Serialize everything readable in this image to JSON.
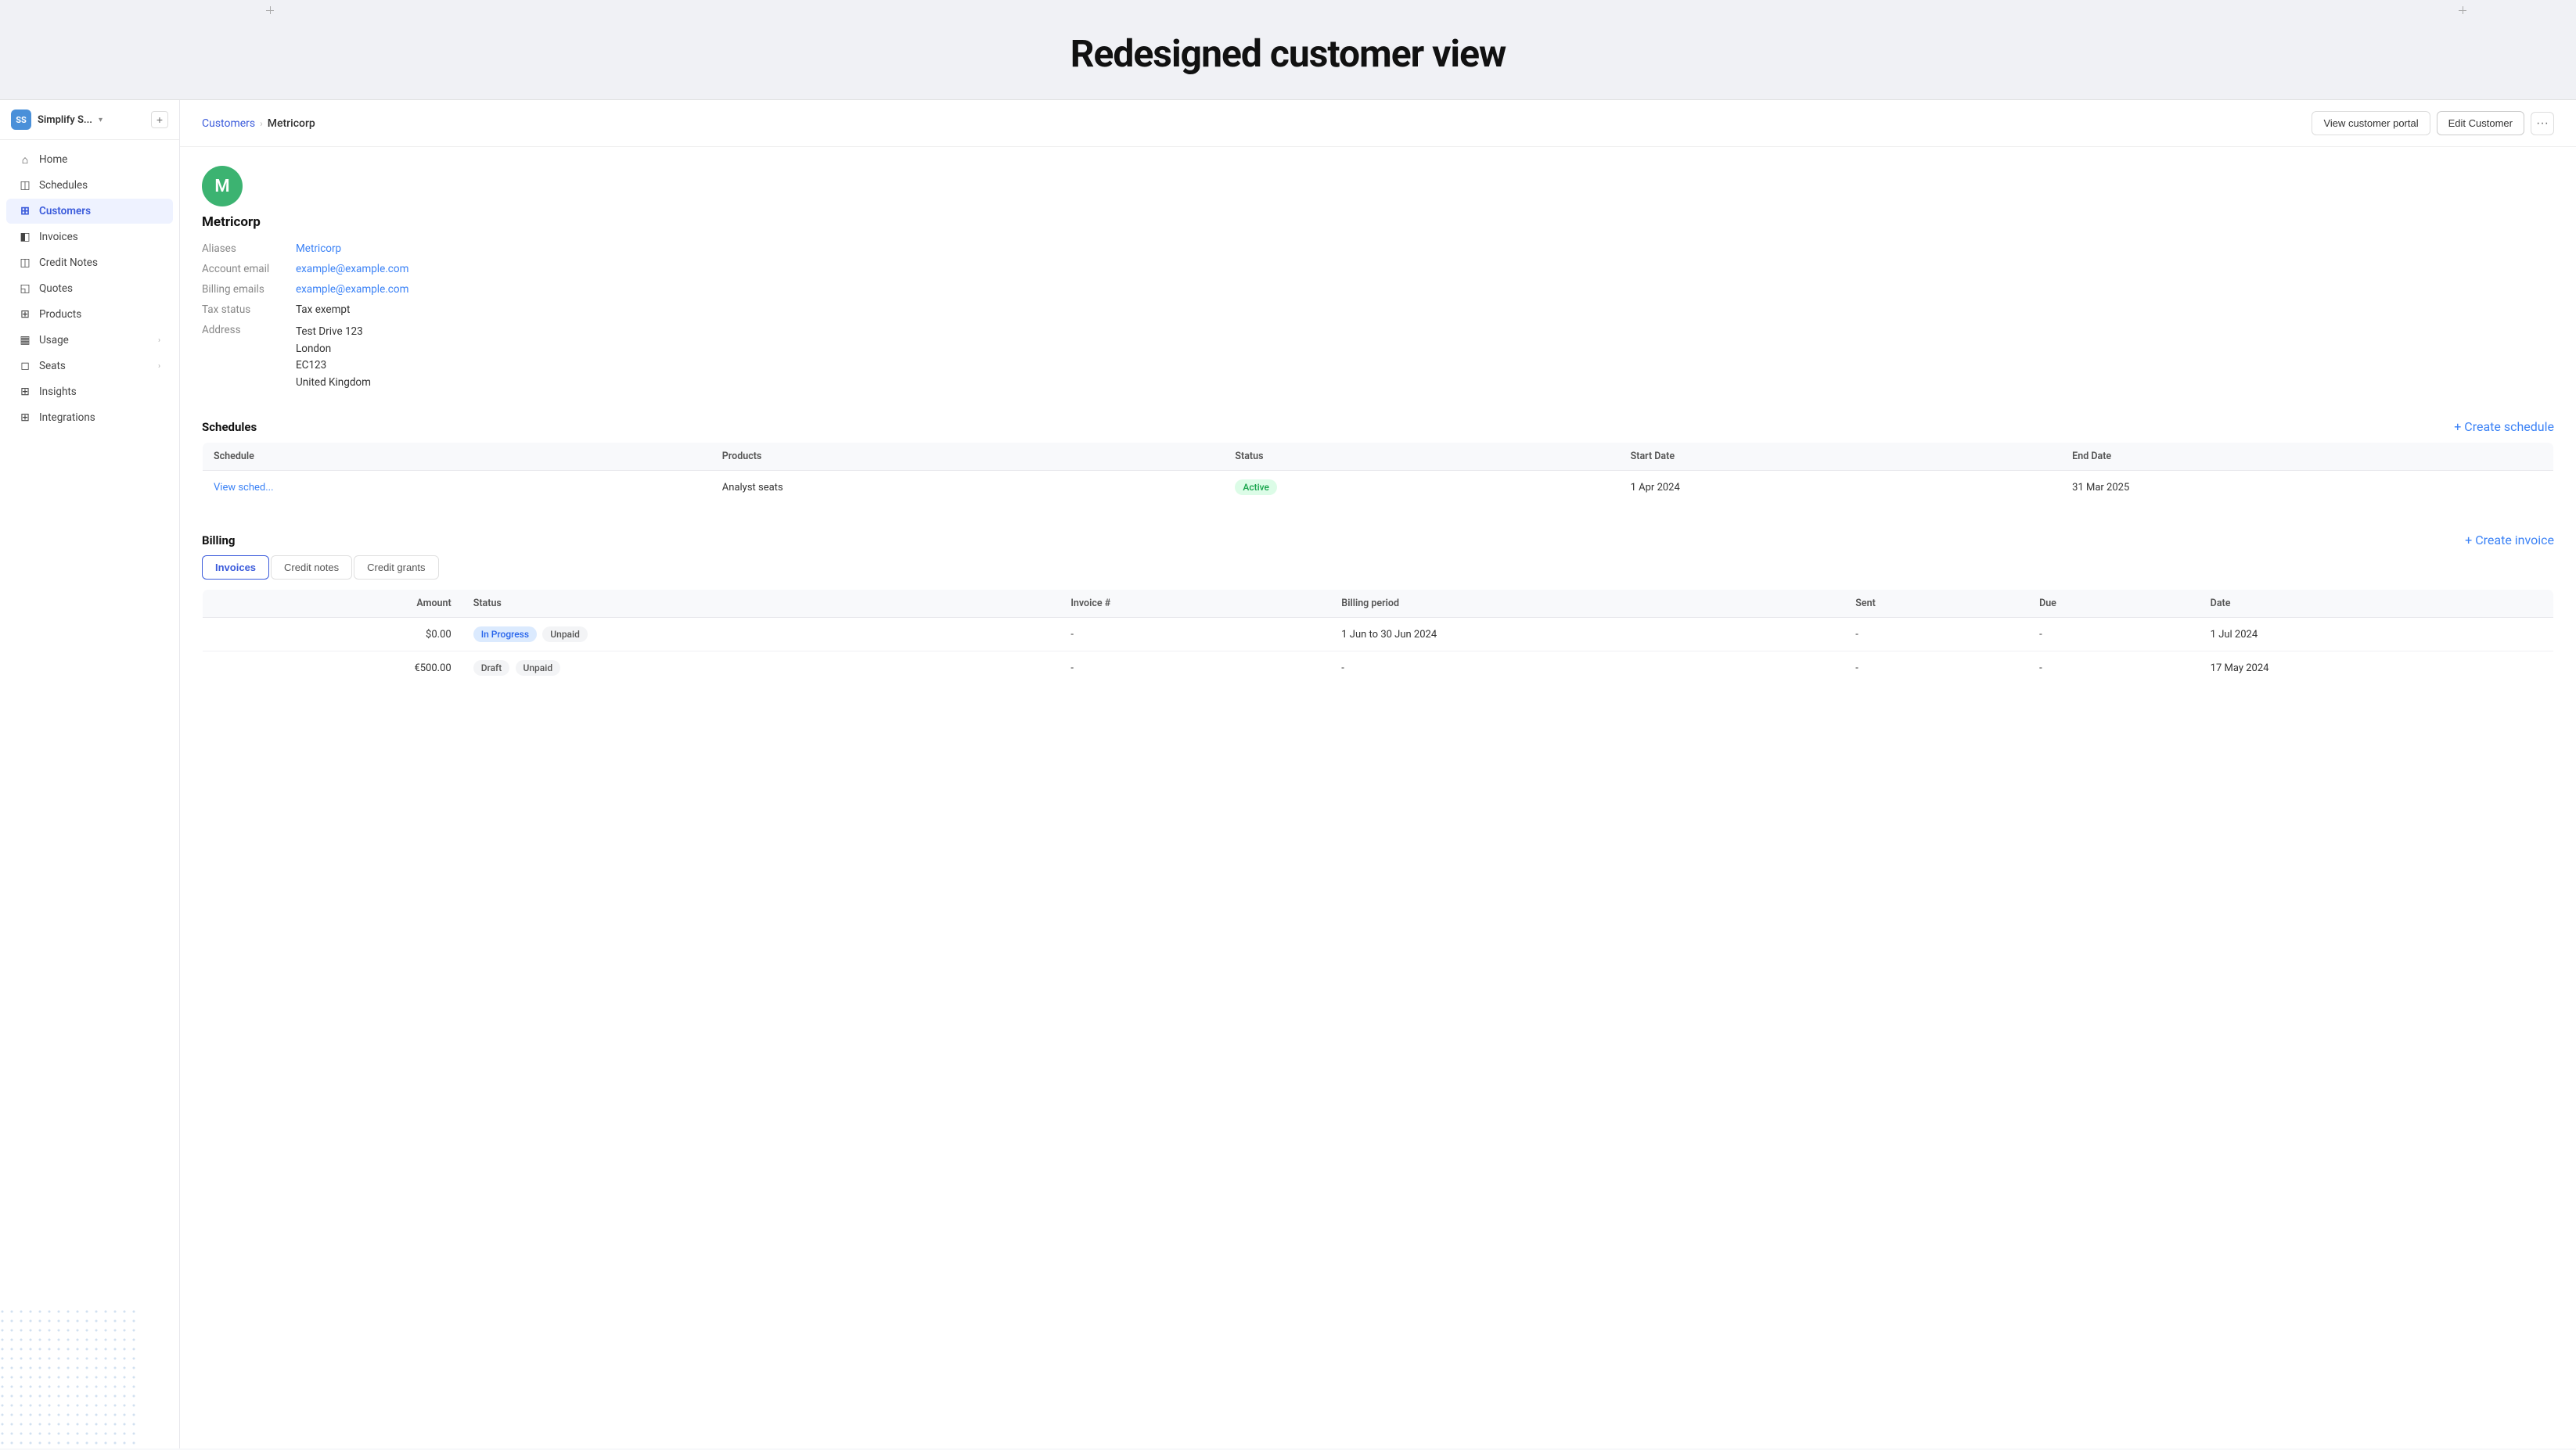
{
  "hero": {
    "title": "Redesigned customer view"
  },
  "sidebar": {
    "brand": {
      "logo": "SS",
      "name": "Simplify S..."
    },
    "items": [
      {
        "id": "home",
        "label": "Home",
        "icon": "🏠",
        "active": false
      },
      {
        "id": "schedules",
        "label": "Schedules",
        "icon": "📅",
        "active": false
      },
      {
        "id": "customers",
        "label": "Customers",
        "icon": "⊞",
        "active": true
      },
      {
        "id": "invoices",
        "label": "Invoices",
        "icon": "📄",
        "active": false
      },
      {
        "id": "credit-notes",
        "label": "Credit Notes",
        "icon": "⊞",
        "active": false
      },
      {
        "id": "quotes",
        "label": "Quotes",
        "icon": "💬",
        "active": false
      },
      {
        "id": "products",
        "label": "Products",
        "icon": "⊞",
        "active": false
      },
      {
        "id": "usage",
        "label": "Usage",
        "icon": "📊",
        "active": false,
        "hasChevron": true
      },
      {
        "id": "seats",
        "label": "Seats",
        "icon": "👥",
        "active": false,
        "hasChevron": true
      },
      {
        "id": "insights",
        "label": "Insights",
        "icon": "⊞",
        "active": false
      },
      {
        "id": "integrations",
        "label": "Integrations",
        "icon": "⊞",
        "active": false
      }
    ]
  },
  "breadcrumb": {
    "parent": "Customers",
    "current": "Metricorp"
  },
  "header_actions": {
    "view_portal": "View customer portal",
    "edit_customer": "Edit Customer"
  },
  "customer": {
    "initial": "M",
    "name": "Metricorp",
    "aliases_label": "Aliases",
    "aliases_value": "Metricorp",
    "account_email_label": "Account email",
    "account_email": "example@example.com",
    "billing_emails_label": "Billing emails",
    "billing_email": "example@example.com",
    "tax_status_label": "Tax status",
    "tax_status": "Tax exempt",
    "address_label": "Address",
    "address_line1": "Test Drive 123",
    "address_line2": "London",
    "address_line3": "EC123",
    "address_line4": "United Kingdom"
  },
  "schedules_section": {
    "title": "Schedules",
    "create_label": "Create schedule",
    "table": {
      "columns": [
        "Schedule",
        "Products",
        "Status",
        "Start Date",
        "End Date"
      ],
      "rows": [
        {
          "schedule": "View sched...",
          "products": "Analyst seats",
          "status": "Active",
          "status_type": "active",
          "start_date": "1 Apr 2024",
          "end_date": "31 Mar 2025"
        }
      ]
    }
  },
  "billing_section": {
    "title": "Billing",
    "tabs": [
      "Invoices",
      "Credit notes",
      "Credit grants"
    ],
    "active_tab": "Invoices",
    "create_label": "Create invoice",
    "table": {
      "columns": [
        "Amount",
        "Status",
        "Invoice #",
        "Billing period",
        "Sent",
        "Due",
        "Date"
      ],
      "rows": [
        {
          "amount": "$0.00",
          "status": "In Progress",
          "status_type": "in-progress",
          "status2": "Unpaid",
          "invoice_num": "-",
          "billing_period": "1 Jun to 30 Jun 2024",
          "sent": "-",
          "due": "-",
          "date": "1 Jul 2024"
        },
        {
          "amount": "€500.00",
          "status": "Draft",
          "status_type": "draft",
          "status2": "Unpaid",
          "invoice_num": "-",
          "billing_period": "-",
          "sent": "-",
          "due": "-",
          "date": "17 May 2024"
        }
      ]
    }
  }
}
